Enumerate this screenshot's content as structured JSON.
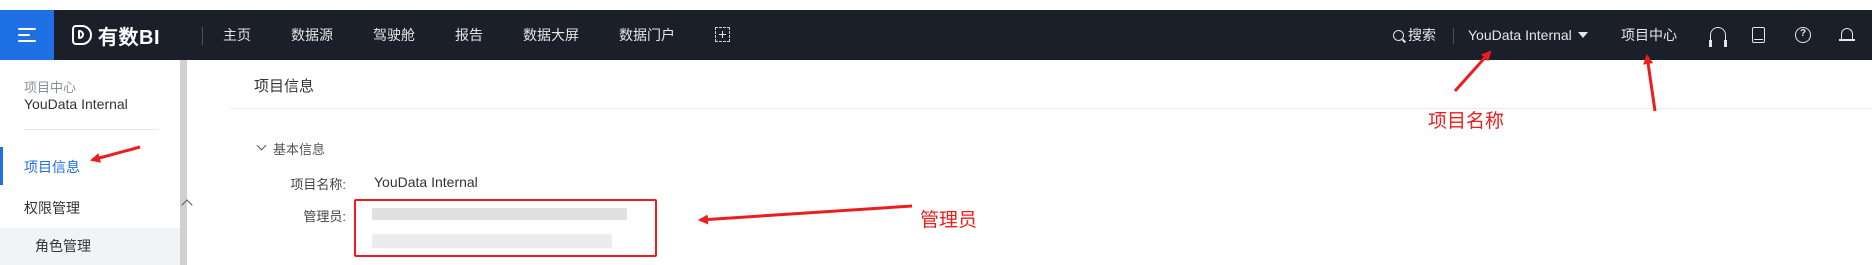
{
  "navbar": {
    "brand": "有数BI",
    "items": [
      "主页",
      "数据源",
      "驾驶舱",
      "报告",
      "数据大屏",
      "数据门户"
    ],
    "search_label": "搜索",
    "project_name": "YouData Internal",
    "project_center": "项目中心"
  },
  "sidebar": {
    "section_small": "项目中心",
    "section_title": "YouData Internal",
    "active_item": "项目信息",
    "group_label": "权限管理",
    "sub_item": "角色管理"
  },
  "main": {
    "header": "项目信息",
    "section_title": "基本信息",
    "fields": {
      "name_label": "项目名称:",
      "name_value": "YouData Internal",
      "admin_label": "管理员:"
    }
  },
  "annotations": {
    "project_name": "项目名称",
    "admin": "管理员"
  },
  "colors": {
    "navbar_bg": "#1b1f2a",
    "accent": "#1f6fe5",
    "annotation_red": "#ee1c1c"
  }
}
